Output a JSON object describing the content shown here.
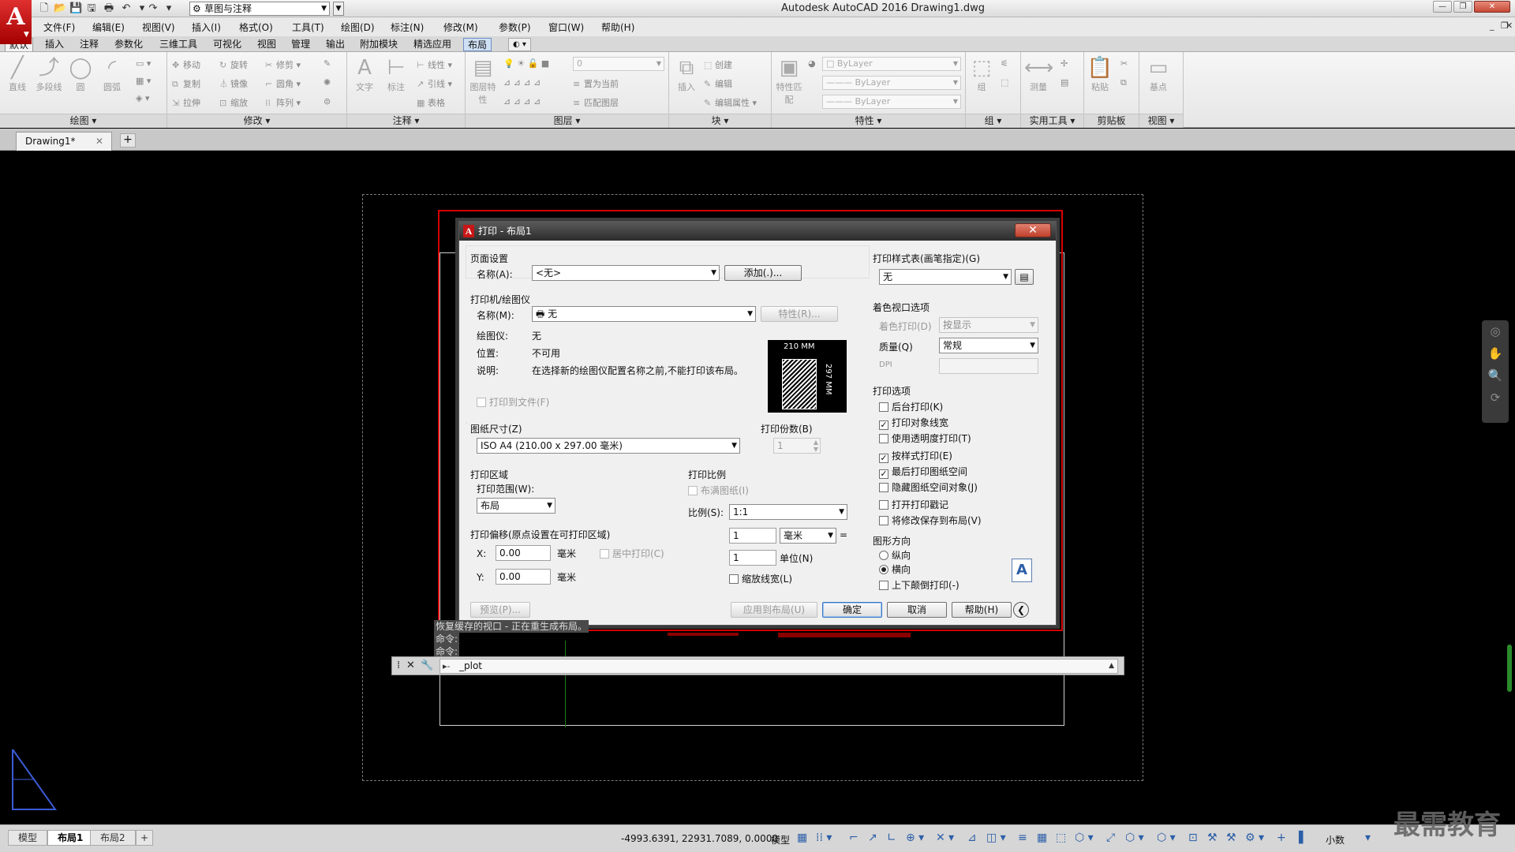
{
  "app": {
    "logo_letter": "A",
    "window_title": "Autodesk AutoCAD 2016    Drawing1.dwg",
    "workspace": "草图与注释"
  },
  "menu": [
    "文件(F)",
    "编辑(E)",
    "视图(V)",
    "插入(I)",
    "格式(O)",
    "工具(T)",
    "绘图(D)",
    "标注(N)",
    "修改(M)",
    "参数(P)",
    "窗口(W)",
    "帮助(H)"
  ],
  "ribbon_tabs": [
    "默认",
    "插入",
    "注释",
    "参数化",
    "三维工具",
    "可视化",
    "视图",
    "管理",
    "输出",
    "附加模块",
    "精选应用",
    "布局"
  ],
  "ribbon": {
    "draw": {
      "title": "绘图",
      "tools": [
        "直线",
        "多段线",
        "圆",
        "圆弧"
      ]
    },
    "modify": {
      "title": "修改",
      "tools": [
        "移动",
        "旋转",
        "修剪",
        "复制",
        "镜像",
        "圆角",
        "拉伸",
        "缩放",
        "阵列"
      ]
    },
    "annotation": {
      "title": "注释",
      "tools": [
        "文字",
        "标注",
        "线性",
        "引线",
        "表格"
      ]
    },
    "layers": {
      "title": "图层",
      "tools": [
        "图层特性",
        "置为当前",
        "匹配图层"
      ],
      "current_layer": "0"
    },
    "block": {
      "title": "块",
      "tools": [
        "插入",
        "创建",
        "编辑",
        "编辑属性"
      ]
    },
    "properties": {
      "title": "特性",
      "tools": [
        "特性匹配"
      ],
      "color": "ByLayer",
      "linetype": "ByLayer",
      "lineweight": "ByLayer"
    },
    "groups": {
      "title": "组",
      "tools": [
        "组"
      ]
    },
    "utilities": {
      "title": "实用工具",
      "tools": [
        "测量"
      ]
    },
    "clipboard": {
      "title": "剪贴板",
      "tools": [
        "粘贴"
      ]
    },
    "view": {
      "title": "视图",
      "tools": [
        "基点"
      ]
    }
  },
  "doc_tab": {
    "name": "Drawing1*"
  },
  "command": {
    "history": [
      "恢复缓存的视口 - 正在重生成布局。",
      "命令:",
      "命令:"
    ],
    "input": "_plot"
  },
  "status": {
    "layout_tabs": [
      "模型",
      "布局1",
      "布局2"
    ],
    "active_tab": "布局1",
    "coords": "-4993.6391, 22931.7089, 0.0000",
    "model": "模型",
    "units": "小数"
  },
  "watermark": "最需教育",
  "dialog": {
    "title": "打印 - 布局1",
    "page_setup": {
      "title": "页面设置",
      "name_label": "名称(A):",
      "name_value": "<无>",
      "add_button": "添加(.)..."
    },
    "printer": {
      "title": "打印机/绘图仪",
      "name_label": "名称(M):",
      "name_value": "无",
      "properties_button": "特性(R)...",
      "plotter_label": "绘图仪:",
      "plotter_value": "无",
      "location_label": "位置:",
      "location_value": "不可用",
      "description_label": "说明:",
      "description_value": "在选择新的绘图仪配置名称之前,不能打印该布局。",
      "plot_to_file": "打印到文件(F)",
      "paper_width": "210 MM",
      "paper_height": "297 MM"
    },
    "paper_size": {
      "title": "图纸尺寸(Z)",
      "value": "ISO A4 (210.00 x 297.00 毫米)"
    },
    "copies": {
      "title": "打印份数(B)",
      "value": "1"
    },
    "plot_area": {
      "title": "打印区域",
      "range_label": "打印范围(W):",
      "range_value": "布局"
    },
    "plot_scale": {
      "title": "打印比例",
      "fit_paper": "布满图纸(I)",
      "scale_label": "比例(S):",
      "scale_value": "1:1",
      "value1": "1",
      "unit1": "毫米",
      "value2": "1",
      "unit2": "单位(N)",
      "scale_lineweights": "缩放线宽(L)"
    },
    "offset": {
      "title": "打印偏移(原点设置在可打印区域)",
      "x_label": "X:",
      "x_value": "0.00",
      "y_label": "Y:",
      "y_value": "0.00",
      "unit": "毫米",
      "center": "居中打印(C)"
    },
    "plot_style": {
      "title": "打印样式表(画笔指定)(G)",
      "value": "无"
    },
    "shaded": {
      "title": "着色视口选项",
      "shade_label": "着色打印(D)",
      "shade_value": "按显示",
      "quality_label": "质量(Q)",
      "quality_value": "常规",
      "dpi_label": "DPI"
    },
    "options": {
      "title": "打印选项",
      "items": [
        {
          "label": "后台打印(K)",
          "checked": false
        },
        {
          "label": "打印对象线宽",
          "checked": true
        },
        {
          "label": "使用透明度打印(T)",
          "checked": false
        },
        {
          "label": "按样式打印(E)",
          "checked": true
        },
        {
          "label": "最后打印图纸空间",
          "checked": true
        },
        {
          "label": "隐藏图纸空间对象(J)",
          "checked": false
        },
        {
          "label": "打开打印戳记",
          "checked": false
        },
        {
          "label": "将修改保存到布局(V)",
          "checked": false
        }
      ]
    },
    "orientation": {
      "title": "图形方向",
      "portrait": "纵向",
      "landscape": "横向",
      "upside_down": "上下颠倒打印(-)",
      "selected": "landscape"
    },
    "buttons": {
      "preview": "预览(P)...",
      "apply": "应用到布局(U)",
      "ok": "确定",
      "cancel": "取消",
      "help": "帮助(H)"
    }
  },
  "colors": {
    "accent_red": "#d40000",
    "canvas": "#000000",
    "layout_tab_active": "#cfe0f5"
  }
}
